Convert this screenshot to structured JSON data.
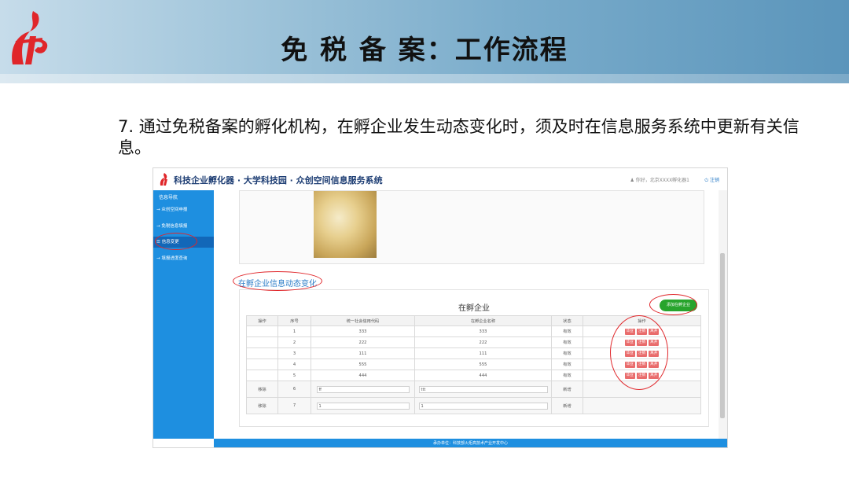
{
  "slide": {
    "title": "免 税 备 案：工作流程",
    "description": "7. 通过免税备案的孵化机构，在孵企业发生动态变化时，须及时在信息服务系统中更新有关信息。",
    "colors": {
      "header_dark": "#5b95bb",
      "header_light": "#c6dcea",
      "annotation": "#e0262a",
      "logo_red": "#e0262a"
    }
  },
  "app": {
    "title": "科技企业孵化器 · 大学科技园 · 众创空间信息服务系统",
    "user_label": "你好，北京XXXX孵化器1",
    "logout_label": "注销",
    "footer": "承办单位：科技部火炬高技术产业开发中心",
    "colors": {
      "sidebar": "#1e8fe0",
      "sidebar_active": "#1267b8",
      "action_button": "#e96c6c",
      "add_button": "#27a42c"
    }
  },
  "sidebar": {
    "heading": "信息导航",
    "items": [
      {
        "label": "众创空间申报",
        "active": false
      },
      {
        "label": "免税信息填报",
        "active": false
      },
      {
        "label": "信息变更",
        "active": true
      },
      {
        "label": "填报进度查询",
        "active": false
      }
    ]
  },
  "main": {
    "section_title": "在孵企业信息动态变化",
    "table_caption": "在孵企业",
    "add_button": "添加在孵企业",
    "columns": [
      "操作",
      "序号",
      "统一社会信用代码",
      "在孵企业名称",
      "状态",
      "操作"
    ],
    "rows": [
      {
        "index": "1",
        "code": "333",
        "name": "333",
        "status": "有效"
      },
      {
        "index": "2",
        "code": "222",
        "name": "222",
        "status": "有效"
      },
      {
        "index": "3",
        "code": "111",
        "name": "111",
        "status": "有效"
      },
      {
        "index": "4",
        "code": "555",
        "name": "555",
        "status": "有效"
      },
      {
        "index": "5",
        "code": "444",
        "name": "444",
        "status": "有效"
      }
    ],
    "row_actions": [
      "毕业",
      "注销",
      "离开"
    ],
    "new_rows": [
      {
        "op": "移除",
        "index": "6",
        "code": "ff",
        "name": "ttt",
        "status": "新增"
      },
      {
        "op": "移除",
        "index": "7",
        "code": "1",
        "name": "1",
        "status": "新增"
      }
    ]
  }
}
